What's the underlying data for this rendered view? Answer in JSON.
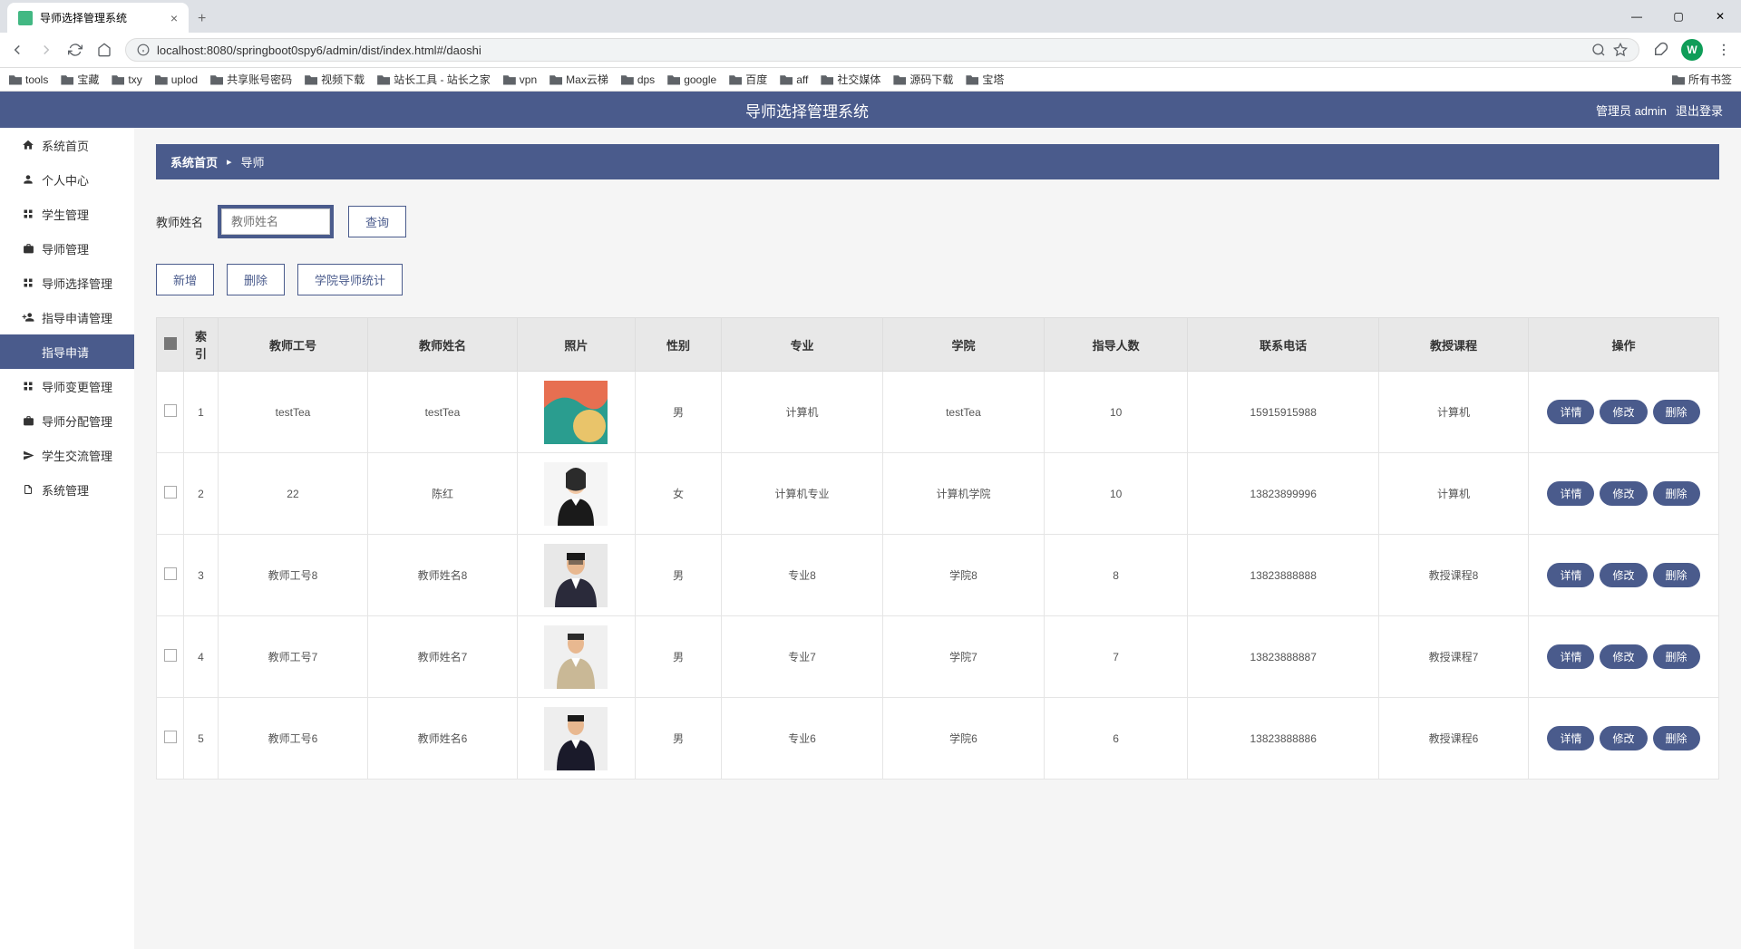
{
  "browser": {
    "tab_title": "导师选择管理系统",
    "url": "localhost:8080/springboot0spy6/admin/dist/index.html#/daoshi",
    "profile_letter": "W"
  },
  "bookmarks": [
    "tools",
    "宝藏",
    "txy",
    "uplod",
    "共享账号密码",
    "视频下载",
    "站长工具 - 站长之家",
    "vpn",
    "Max云梯",
    "dps",
    "google",
    "百度",
    "aff",
    "社交媒体",
    "源码下载",
    "宝塔"
  ],
  "bookmark_right": "所有书签",
  "header": {
    "title": "导师选择管理系统",
    "user_label": "管理员 admin",
    "logout": "退出登录"
  },
  "sidebar": {
    "items": [
      {
        "label": "系统首页",
        "icon": "home"
      },
      {
        "label": "个人中心",
        "icon": "person"
      },
      {
        "label": "学生管理",
        "icon": "grid"
      },
      {
        "label": "导师管理",
        "icon": "briefcase"
      },
      {
        "label": "导师选择管理",
        "icon": "grid"
      },
      {
        "label": "指导申请管理",
        "icon": "person-add"
      },
      {
        "label": "指导申请",
        "icon": "",
        "active": true
      },
      {
        "label": "导师变更管理",
        "icon": "grid"
      },
      {
        "label": "导师分配管理",
        "icon": "briefcase"
      },
      {
        "label": "学生交流管理",
        "icon": "send"
      },
      {
        "label": "系统管理",
        "icon": "file"
      }
    ]
  },
  "breadcrumb": {
    "home": "系统首页",
    "current": "导师"
  },
  "search": {
    "label": "教师姓名",
    "placeholder": "教师姓名",
    "query_btn": "查询"
  },
  "actions": {
    "add": "新增",
    "delete": "删除",
    "stats": "学院导师统计"
  },
  "table": {
    "headers": [
      "索引",
      "教师工号",
      "教师姓名",
      "照片",
      "性别",
      "专业",
      "学院",
      "指导人数",
      "联系电话",
      "教授课程",
      "操作"
    ],
    "btn_detail": "详情",
    "btn_edit": "修改",
    "btn_delete": "删除",
    "rows": [
      {
        "idx": "1",
        "tid": "testTea",
        "name": "testTea",
        "gender": "男",
        "major": "计算机",
        "college": "testTea",
        "count": "10",
        "phone": "15915915988",
        "course": "计算机",
        "photo": "abstract"
      },
      {
        "idx": "2",
        "tid": "22",
        "name": "陈红",
        "gender": "女",
        "major": "计算机专业",
        "college": "计算机学院",
        "count": "10",
        "phone": "13823899996",
        "course": "计算机",
        "photo": "woman"
      },
      {
        "idx": "3",
        "tid": "教师工号8",
        "name": "教师姓名8",
        "gender": "男",
        "major": "专业8",
        "college": "学院8",
        "count": "8",
        "phone": "13823888888",
        "course": "教授课程8",
        "photo": "man-suit"
      },
      {
        "idx": "4",
        "tid": "教师工号7",
        "name": "教师姓名7",
        "gender": "男",
        "major": "专业7",
        "college": "学院7",
        "count": "7",
        "phone": "13823888887",
        "course": "教授课程7",
        "photo": "man-tan"
      },
      {
        "idx": "5",
        "tid": "教师工号6",
        "name": "教师姓名6",
        "gender": "男",
        "major": "专业6",
        "college": "学院6",
        "count": "6",
        "phone": "13823888886",
        "course": "教授课程6",
        "photo": "man-dark"
      }
    ]
  }
}
